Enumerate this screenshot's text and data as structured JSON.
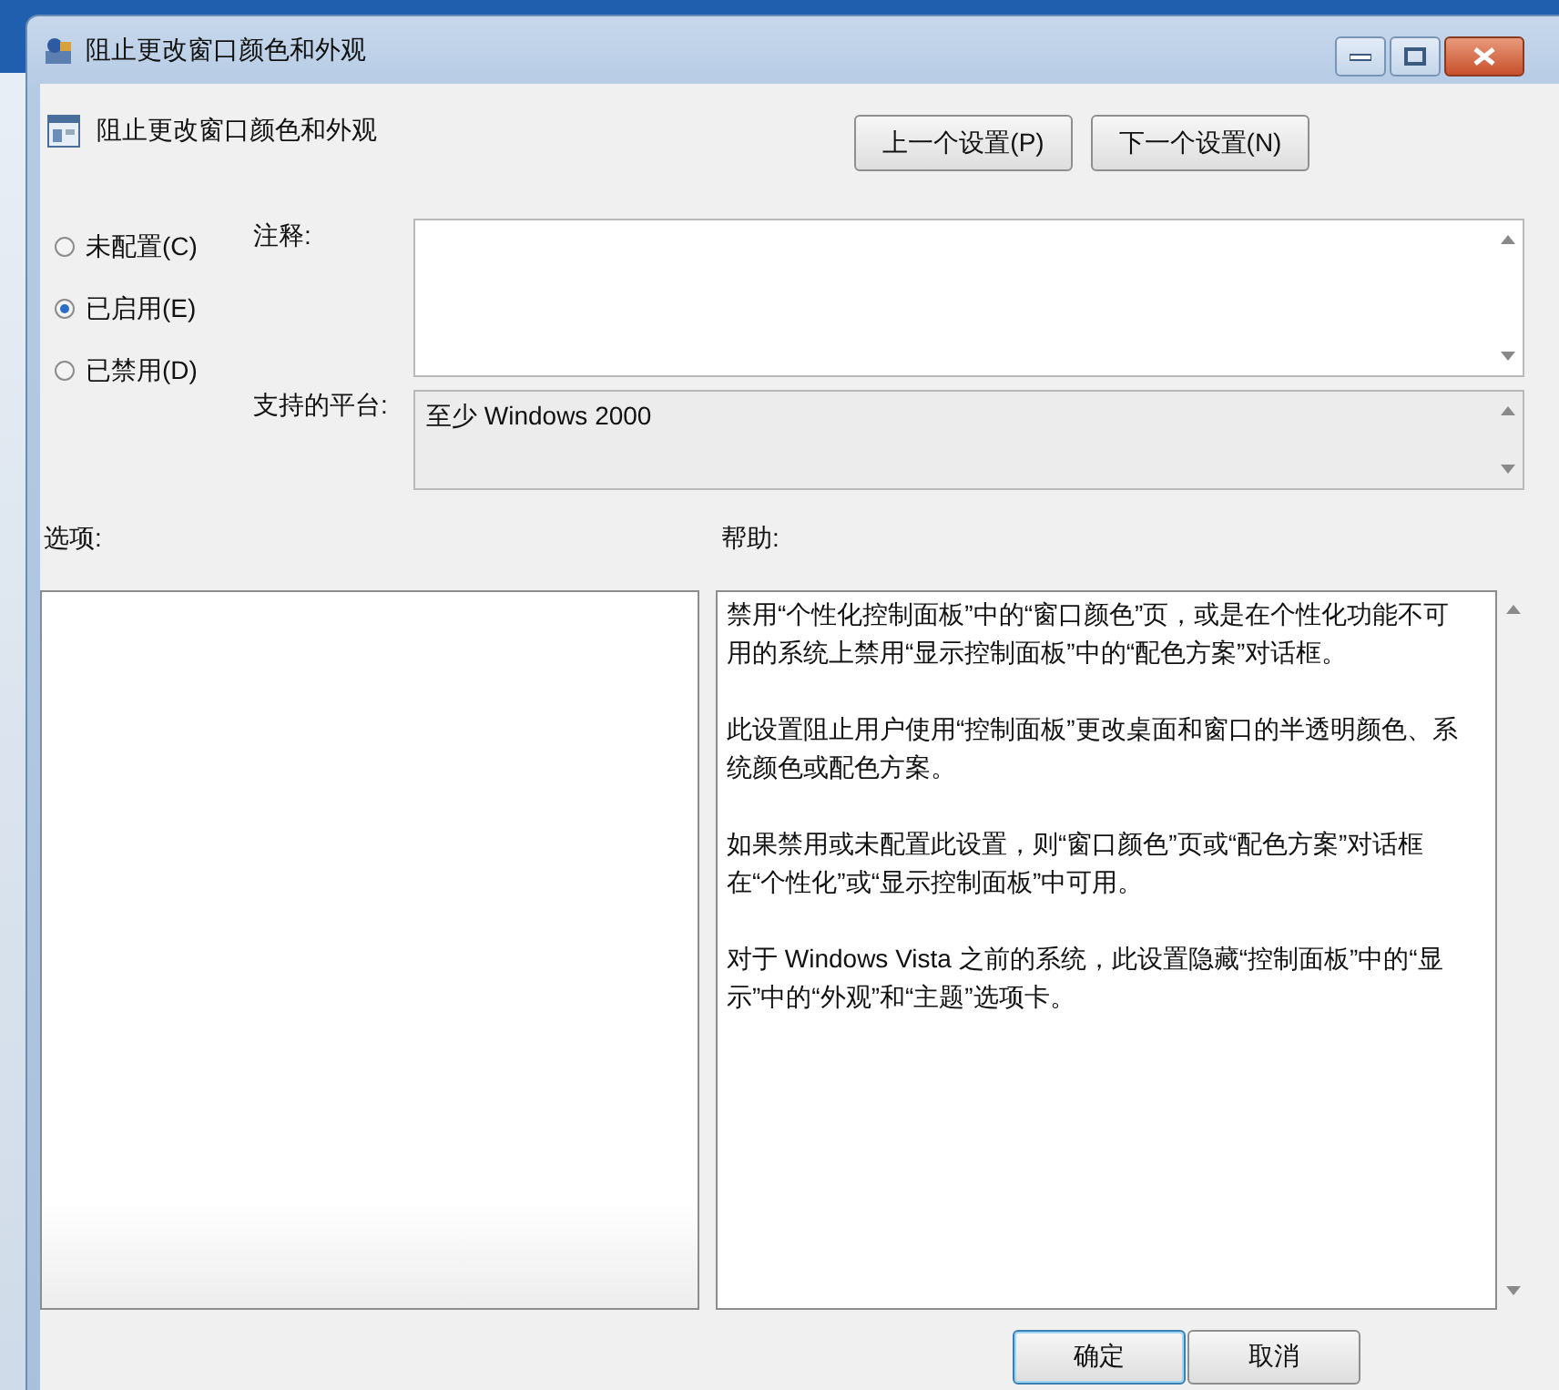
{
  "window": {
    "title": "阻止更改窗口颜色和外观"
  },
  "header": {
    "title": "阻止更改窗口颜色和外观"
  },
  "nav_buttons": [
    "上一个设置(P)",
    "下一个设置(N)"
  ],
  "state_options": [
    {
      "label": "未配置(C)",
      "selected": false
    },
    {
      "label": "已启用(E)",
      "selected": true
    },
    {
      "label": "已禁用(D)",
      "selected": false
    }
  ],
  "comment": {
    "label": "注释:"
  },
  "platform": {
    "label": "支持的平台:",
    "value": "至少 Windows 2000"
  },
  "options": {
    "label": "选项:"
  },
  "help": {
    "label": "帮助:",
    "paragraphs": [
      "禁用“个性化控制面板”中的“窗口颜色”页，或是在个性化功能不可用的系统上禁用“显示控制面板”中的“配色方案”对话框。",
      "此设置阻止用户使用“控制面板”更改桌面和窗口的半透明颜色、系统颜色或配色方案。",
      "如果禁用或未配置此设置，则“窗口颜色”页或“配色方案”对话框在“个性化”或“显示控制面板”中可用。",
      "对于 Windows Vista 之前的系统，此设置隐藏“控制面板”中的“显示”中的“外观”和“主题”选项卡。"
    ]
  },
  "buttons": [
    "确定",
    "取消"
  ]
}
